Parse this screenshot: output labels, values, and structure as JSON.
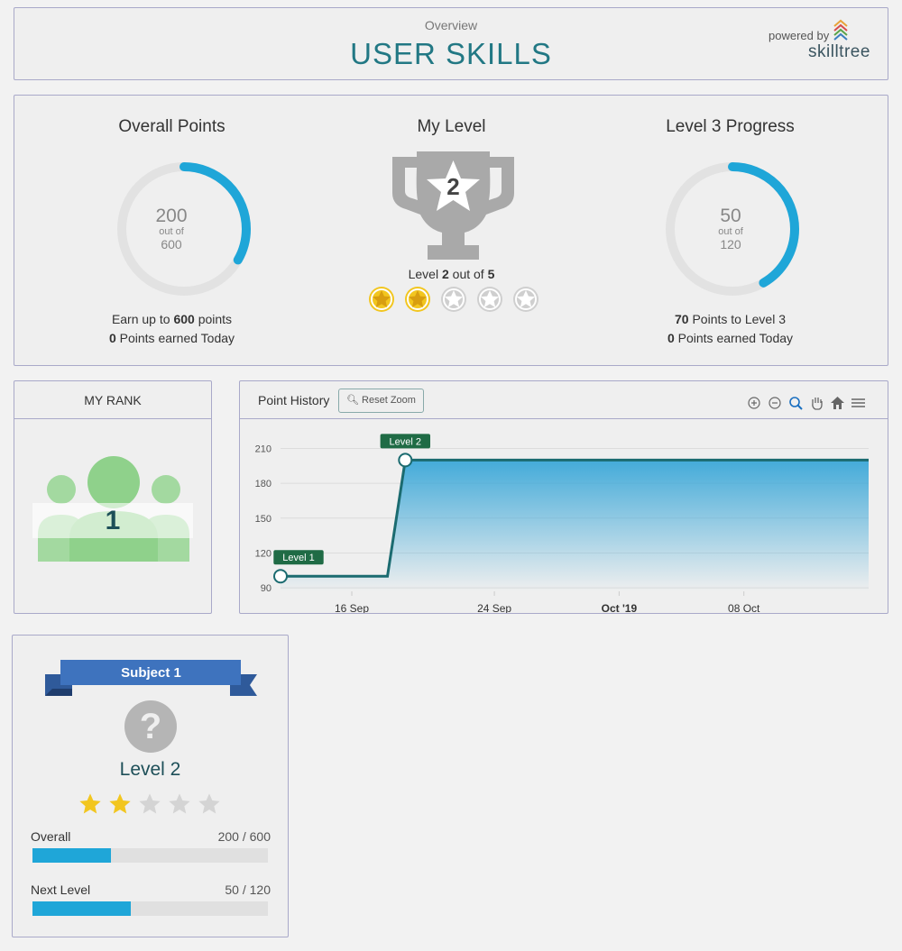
{
  "header": {
    "overview_label": "Overview",
    "title": "USER SKILLS",
    "powered_by": "powered by",
    "brand": "skilltree"
  },
  "summary": {
    "points": {
      "title": "Overall Points",
      "value": "200",
      "out_of": "out of",
      "total": "600",
      "fraction": 0.333,
      "earn_prefix": "Earn up to",
      "earn_value": "600",
      "earn_suffix": "points",
      "today_value": "0",
      "today_label": "Points earned Today"
    },
    "level": {
      "title": "My Level",
      "current": "2",
      "level_word": "Level",
      "out_of": "out of",
      "max": "5",
      "stars_earned": 2,
      "stars_total": 5
    },
    "progress": {
      "title": "Level 3 Progress",
      "value": "50",
      "out_of": "out of",
      "total": "120",
      "fraction": 0.4167,
      "remaining_value": "70",
      "remaining_label": "Points to Level 3",
      "today_value": "0",
      "today_label": "Points earned Today"
    }
  },
  "rank": {
    "title": "MY RANK",
    "value": "1"
  },
  "history": {
    "title": "Point History",
    "reset_label": "Reset Zoom",
    "tools": [
      "zoom-in-icon",
      "zoom-out-icon",
      "selection-zoom-icon",
      "pan-icon",
      "reset-home-icon",
      "menu-icon"
    ]
  },
  "chart_data": {
    "type": "area",
    "title": "",
    "xlabel": "",
    "ylabel": "",
    "x_ticks": [
      "16 Sep",
      "24 Sep",
      "Oct '19",
      "08 Oct"
    ],
    "y_ticks": [
      90,
      120,
      150,
      180,
      210
    ],
    "ylim": [
      87,
      222
    ],
    "x": [
      "2019-09-12",
      "2019-09-18",
      "2019-09-19",
      "2019-10-13"
    ],
    "series": [
      {
        "values": [
          100,
          100,
          200,
          200
        ]
      }
    ],
    "annotations": [
      {
        "label": "Level 1",
        "x": "2019-09-12",
        "y": 100
      },
      {
        "label": "Level 2",
        "x": "2019-09-19",
        "y": 200
      }
    ],
    "x_range": [
      "2019-09-12",
      "2019-10-15"
    ],
    "tick_dates": [
      "2019-09-16",
      "2019-09-24",
      "2019-10-01",
      "2019-10-08"
    ],
    "colors": {
      "line": "#1b6b70",
      "fill_top": "#3aa7d8",
      "label_bg": "#1f6b45"
    }
  },
  "subject": {
    "name": "Subject 1",
    "level": "Level 2",
    "stars_earned": 2,
    "stars_total": 5,
    "overall_label": "Overall",
    "overall_value": "200 / 600",
    "overall_fraction": 0.333,
    "next_label": "Next Level",
    "next_value": "50 / 120",
    "next_fraction": 0.4167
  },
  "colors": {
    "accent": "#1fa6d8",
    "title": "#227884",
    "star_gold": "#f2c61f",
    "star_gray": "#cfcfcf",
    "ribbon": "#3e73be"
  }
}
